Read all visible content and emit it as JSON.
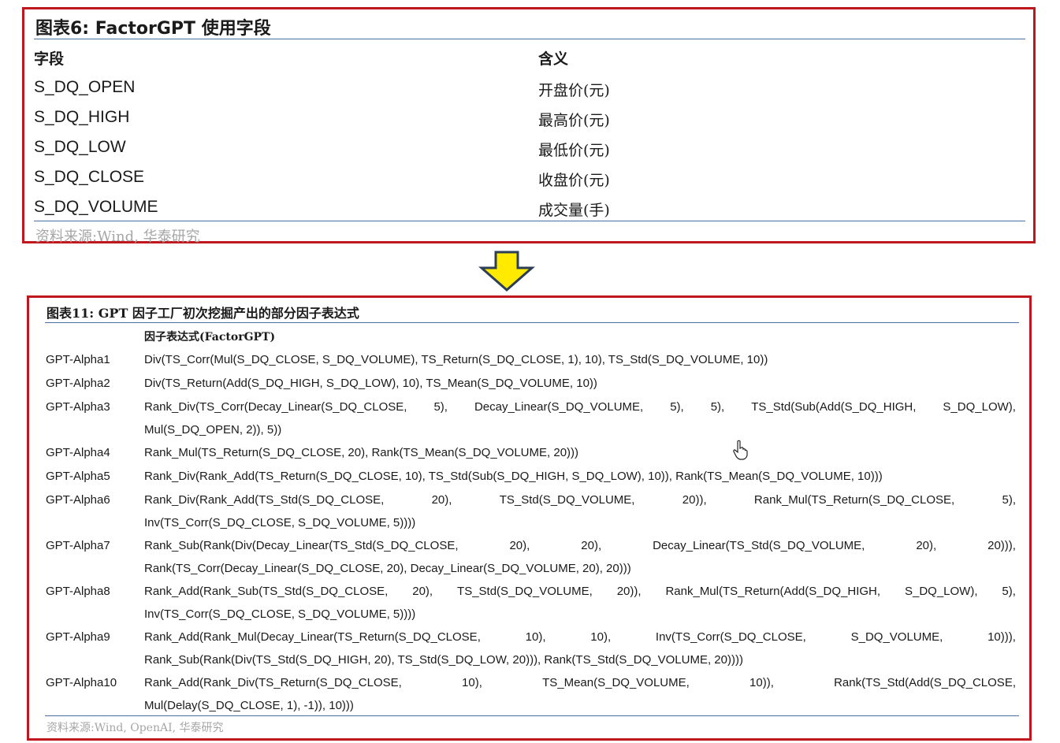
{
  "table6": {
    "title": "图表6:  FactorGPT 使用字段",
    "header_field": "字段",
    "header_meaning": "含义",
    "rows": [
      {
        "field": "S_DQ_OPEN",
        "meaning": "开盘价(元)"
      },
      {
        "field": "S_DQ_HIGH",
        "meaning": "最高价(元)"
      },
      {
        "field": "S_DQ_LOW",
        "meaning": "最低价(元)"
      },
      {
        "field": "S_DQ_CLOSE",
        "meaning": "收盘价(元)"
      },
      {
        "field": "S_DQ_VOLUME",
        "meaning": "成交量(手)"
      }
    ],
    "source": "资料来源:Wind, 华泰研究"
  },
  "table11": {
    "title": "图表11:  GPT 因子工厂初次挖掘产出的部分因子表达式",
    "header_expr": "因子表达式(FactorGPT)",
    "rows": [
      {
        "name": "GPT-Alpha1",
        "line1": "Div(TS_Corr(Mul(S_DQ_CLOSE, S_DQ_VOLUME), TS_Return(S_DQ_CLOSE, 1), 10), TS_Std(S_DQ_VOLUME, 10))",
        "line2": ""
      },
      {
        "name": "GPT-Alpha2",
        "line1": "Div(TS_Return(Add(S_DQ_HIGH, S_DQ_LOW), 10), TS_Mean(S_DQ_VOLUME, 10))",
        "line2": ""
      },
      {
        "name": "GPT-Alpha3",
        "line1": "Rank_Div(TS_Corr(Decay_Linear(S_DQ_CLOSE, 5), Decay_Linear(S_DQ_VOLUME, 5), 5), TS_Std(Sub(Add(S_DQ_HIGH, S_DQ_LOW),",
        "line2": "Mul(S_DQ_OPEN, 2)), 5))"
      },
      {
        "name": "GPT-Alpha4",
        "line1": "Rank_Mul(TS_Return(S_DQ_CLOSE, 20), Rank(TS_Mean(S_DQ_VOLUME, 20)))",
        "line2": ""
      },
      {
        "name": "GPT-Alpha5",
        "line1": "Rank_Div(Rank_Add(TS_Return(S_DQ_CLOSE, 10), TS_Std(Sub(S_DQ_HIGH, S_DQ_LOW), 10)), Rank(TS_Mean(S_DQ_VOLUME, 10)))",
        "line2": ""
      },
      {
        "name": "GPT-Alpha6",
        "line1": "Rank_Div(Rank_Add(TS_Std(S_DQ_CLOSE, 20), TS_Std(S_DQ_VOLUME, 20)), Rank_Mul(TS_Return(S_DQ_CLOSE, 5),",
        "line2": "Inv(TS_Corr(S_DQ_CLOSE, S_DQ_VOLUME, 5))))"
      },
      {
        "name": "GPT-Alpha7",
        "line1": "Rank_Sub(Rank(Div(Decay_Linear(TS_Std(S_DQ_CLOSE, 20), 20), Decay_Linear(TS_Std(S_DQ_VOLUME, 20), 20))),",
        "line2": "Rank(TS_Corr(Decay_Linear(S_DQ_CLOSE, 20), Decay_Linear(S_DQ_VOLUME, 20), 20)))"
      },
      {
        "name": "GPT-Alpha8",
        "line1": "Rank_Add(Rank_Sub(TS_Std(S_DQ_CLOSE, 20), TS_Std(S_DQ_VOLUME, 20)), Rank_Mul(TS_Return(Add(S_DQ_HIGH, S_DQ_LOW), 5),",
        "line2": "Inv(TS_Corr(S_DQ_CLOSE, S_DQ_VOLUME, 5))))"
      },
      {
        "name": "GPT-Alpha9",
        "line1": "Rank_Add(Rank_Mul(Decay_Linear(TS_Return(S_DQ_CLOSE, 10), 10), Inv(TS_Corr(S_DQ_CLOSE, S_DQ_VOLUME, 10))),",
        "line2": "Rank_Sub(Rank(Div(TS_Std(S_DQ_HIGH, 20), TS_Std(S_DQ_LOW, 20))), Rank(TS_Std(S_DQ_VOLUME, 20))))"
      },
      {
        "name": "GPT-Alpha10",
        "line1": "Rank_Add(Rank_Div(TS_Return(S_DQ_CLOSE, 10), TS_Mean(S_DQ_VOLUME, 10)), Rank(TS_Std(Add(S_DQ_CLOSE,",
        "line2": "Mul(Delay(S_DQ_CLOSE, 1), -1)), 10)))"
      }
    ],
    "source": "资料来源:Wind, OpenAI, 华泰研究"
  },
  "colors": {
    "border": "#c0171f",
    "arrow_fill": "#ffea00",
    "rule": "#4a6fa5",
    "source_text": "#a6a6a6"
  },
  "icons": {
    "arrow": "down-arrow-icon",
    "cursor": "hand-pointer-icon"
  }
}
